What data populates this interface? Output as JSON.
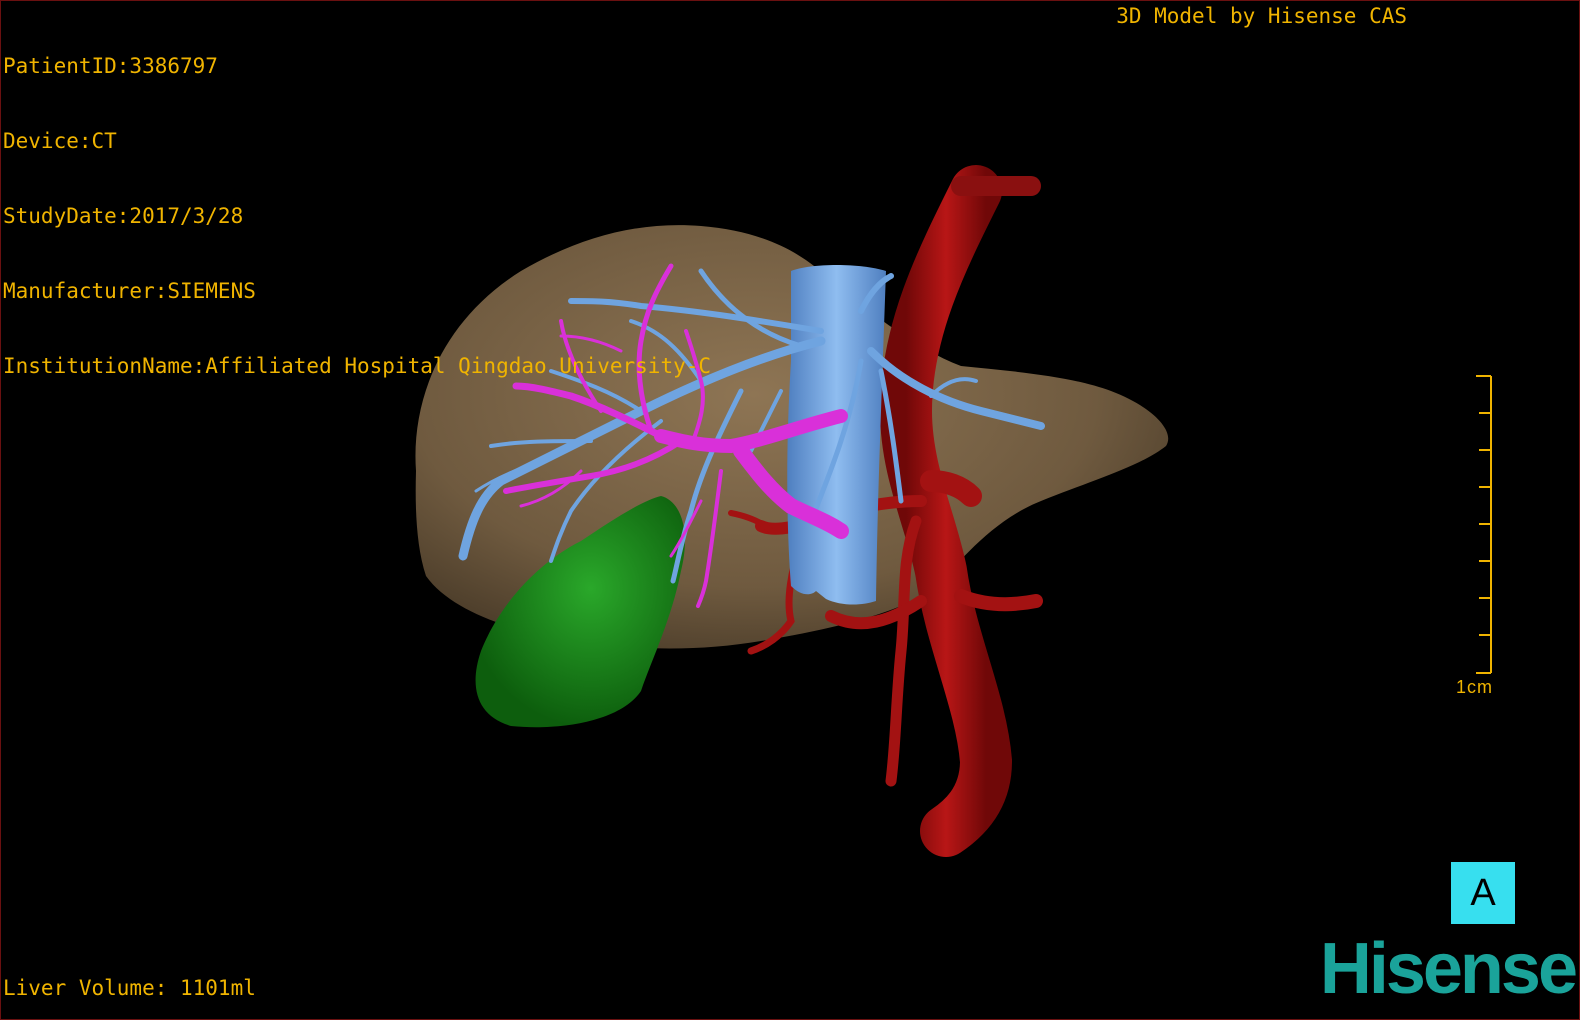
{
  "header": {
    "patient_id": "PatientID:3386797",
    "device": "Device:CT",
    "study_date": "StudyDate:2017/3/28",
    "manufacturer": "Manufacturer:SIEMENS",
    "institution": "InstitutionName:Affiliated Hospital Qingdao University-C",
    "title": "3D Model by Hisense CAS"
  },
  "footer": {
    "liver_volume": "Liver Volume: 1101ml"
  },
  "scale_bar": {
    "label": "1cm"
  },
  "orientation": {
    "label": "A"
  },
  "brand": {
    "logo_text": "Hisense"
  },
  "colors": {
    "overlay_text": "#f0b400",
    "liver": "#7a6346",
    "hepatic_vein": "#6fa4e0",
    "portal_vein": "#d930d9",
    "artery": "#a01010",
    "gallbladder": "#1b8a1b",
    "orientation_box": "#37dfef",
    "logo": "#1aa39a"
  }
}
